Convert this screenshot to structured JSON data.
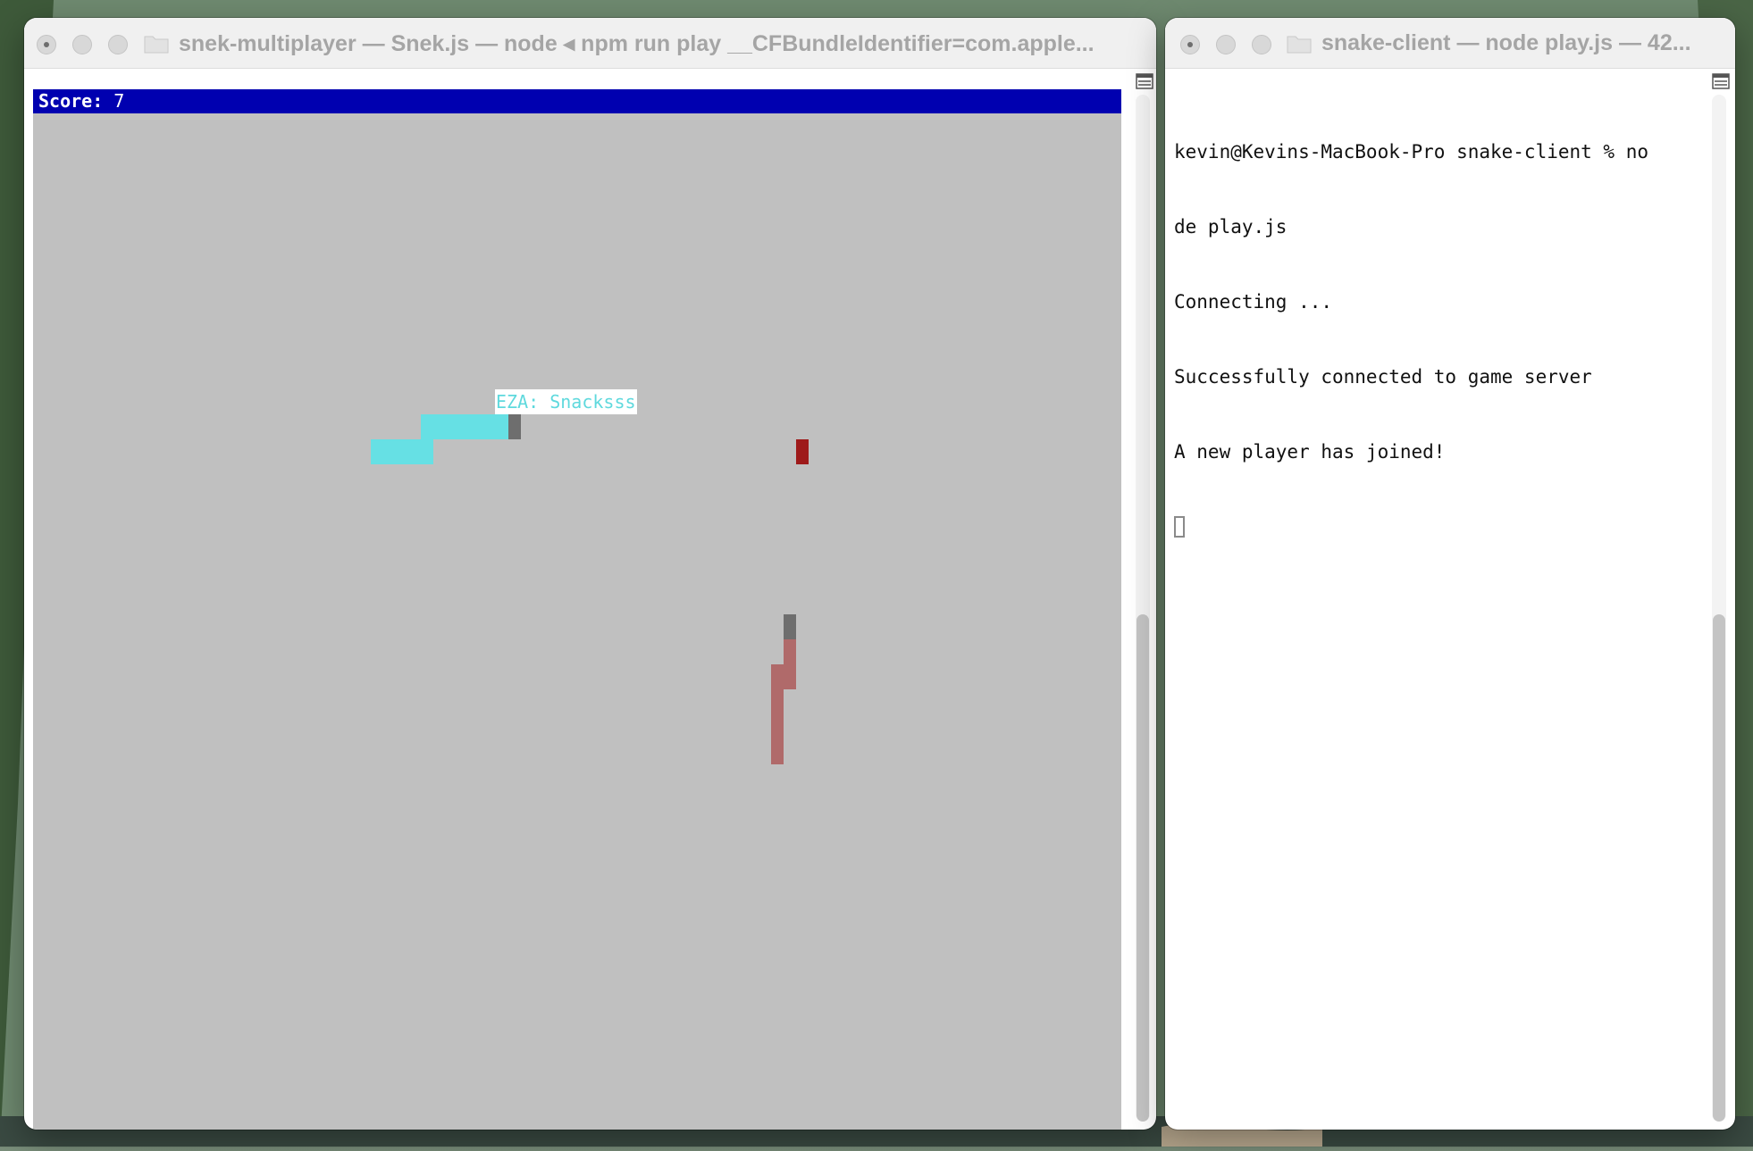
{
  "desktop": {
    "colors": {
      "sky": "#7a8f7b",
      "foliage": "#3b5534",
      "rock": "#b9a98f"
    }
  },
  "left_window": {
    "title": "snek-multiplayer — Snek.js — node ◂ npm run play __CFBundleIdentifier=com.apple...",
    "icons": [
      "close-button",
      "minimize-button",
      "zoom-button",
      "folder-icon",
      "split-pane-icon"
    ],
    "game": {
      "score_label": "Score:",
      "score_value": "7",
      "background_color": "#c0c0c0",
      "score_bar_color": "#0000b0",
      "players": [
        {
          "label": "EZA: Snacksss",
          "color": "#66e0e4",
          "head_color": "#6e6e6e",
          "label_color": "#5fd9dd"
        },
        {
          "label": "",
          "color": "#b06a6a",
          "head_color": "#6e6e6e"
        }
      ],
      "food_color": "#9e1a1a"
    }
  },
  "right_window": {
    "title": "snake-client — node play.js — 42...",
    "icons": [
      "close-button",
      "minimize-button",
      "zoom-button",
      "folder-icon",
      "split-pane-icon"
    ],
    "terminal_lines": [
      "kevin@Kevins-MacBook-Pro snake-client % no",
      "de play.js",
      "Connecting ...",
      "Successfully connected to game server",
      "A new player has joined!"
    ]
  }
}
